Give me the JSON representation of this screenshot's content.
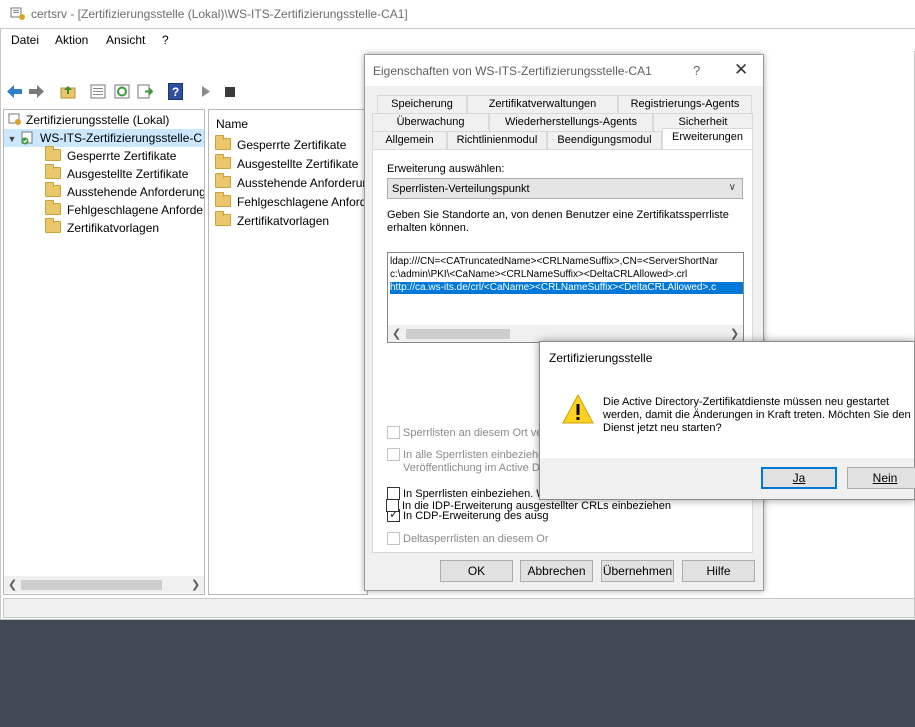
{
  "window": {
    "title": "certsrv - [Zertifizierungsstelle (Lokal)\\WS-ITS-Zertifizierungsstelle-CA1]",
    "menu": [
      "Datei",
      "Aktion",
      "Ansicht",
      "?"
    ]
  },
  "tree": {
    "root": "Zertifizierungsstelle (Lokal)",
    "ca": "WS-ITS-Zertifizierungsstelle-C",
    "items": [
      "Gesperrte Zertifikate",
      "Ausgestellte Zertifikate",
      "Ausstehende Anforderung",
      "Fehlgeschlagene Anforder",
      "Zertifikatvorlagen"
    ]
  },
  "list": {
    "header": "Name",
    "items": [
      "Gesperrte Zertifikate",
      "Ausgestellte Zertifikate",
      "Ausstehende Anforderun",
      "Fehlgeschlagene Anforde",
      "Zertifikatvorlagen"
    ]
  },
  "dialog": {
    "title": "Eigenschaften von WS-ITS-Zertifizierungsstelle-CA1",
    "help_glyph": "?",
    "tabs_row1": [
      "Speicherung",
      "Zertifikatverwaltungen",
      "Registrierungs-Agents"
    ],
    "tabs_row2": [
      "Überwachung",
      "Wiederherstellungs-Agents",
      "Sicherheit"
    ],
    "tabs_row3": [
      "Allgemein",
      "Richtlinienmodul",
      "Beendigungsmodul",
      "Erweiterungen"
    ],
    "extension_label": "Erweiterung auswählen:",
    "extension_value": "Sperrlisten-Verteilungspunkt",
    "locations_label_1": "Geben Sie Standorte an, von denen Benutzer eine Zertifikatssperrliste",
    "locations_label_2": "erhalten können.",
    "locations": [
      "ldap:///CN=<CATruncatedName><CRLNameSuffix>,CN=<ServerShortNar",
      "c:\\admin\\PKI\\<CaName><CRLNameSuffix><DeltaCRLAllowed>.crl",
      "http://ca.ws-its.de/crl/<CaName><CRLNameSuffix><DeltaCRLAllowed>.c"
    ],
    "options": [
      {
        "label": "Sperrlisten an diesem Ort verö",
        "checked": false,
        "enabled": false
      },
      {
        "label": "In alle Sperrlisten einbeziehen",
        "label2": "Veröffentlichung im Active Dir",
        "checked": false,
        "enabled": false
      },
      {
        "label": "In Sperrlisten einbeziehen. W",
        "checked": false,
        "enabled": true
      },
      {
        "label": "In CDP-Erweiterung des ausg",
        "checked": true,
        "enabled": true
      },
      {
        "label": "Deltasperrlisten an diesem Or",
        "checked": false,
        "enabled": false
      },
      {
        "label": "In die IDP-Erweiterung ausgestellter CRLs einbeziehen",
        "checked": false,
        "enabled": true
      }
    ],
    "buttons": [
      "OK",
      "Abbrechen",
      "Übernehmen",
      "Hilfe"
    ]
  },
  "msgbox": {
    "title": "Zertifizierungsstelle",
    "text": "Die Active Directory-Zertifikatdienste müssen neu gestartet werden, damit die Änderungen in Kraft treten. Möchten Sie den Dienst jetzt neu starten?",
    "yes": "Ja",
    "no": "Nein"
  }
}
